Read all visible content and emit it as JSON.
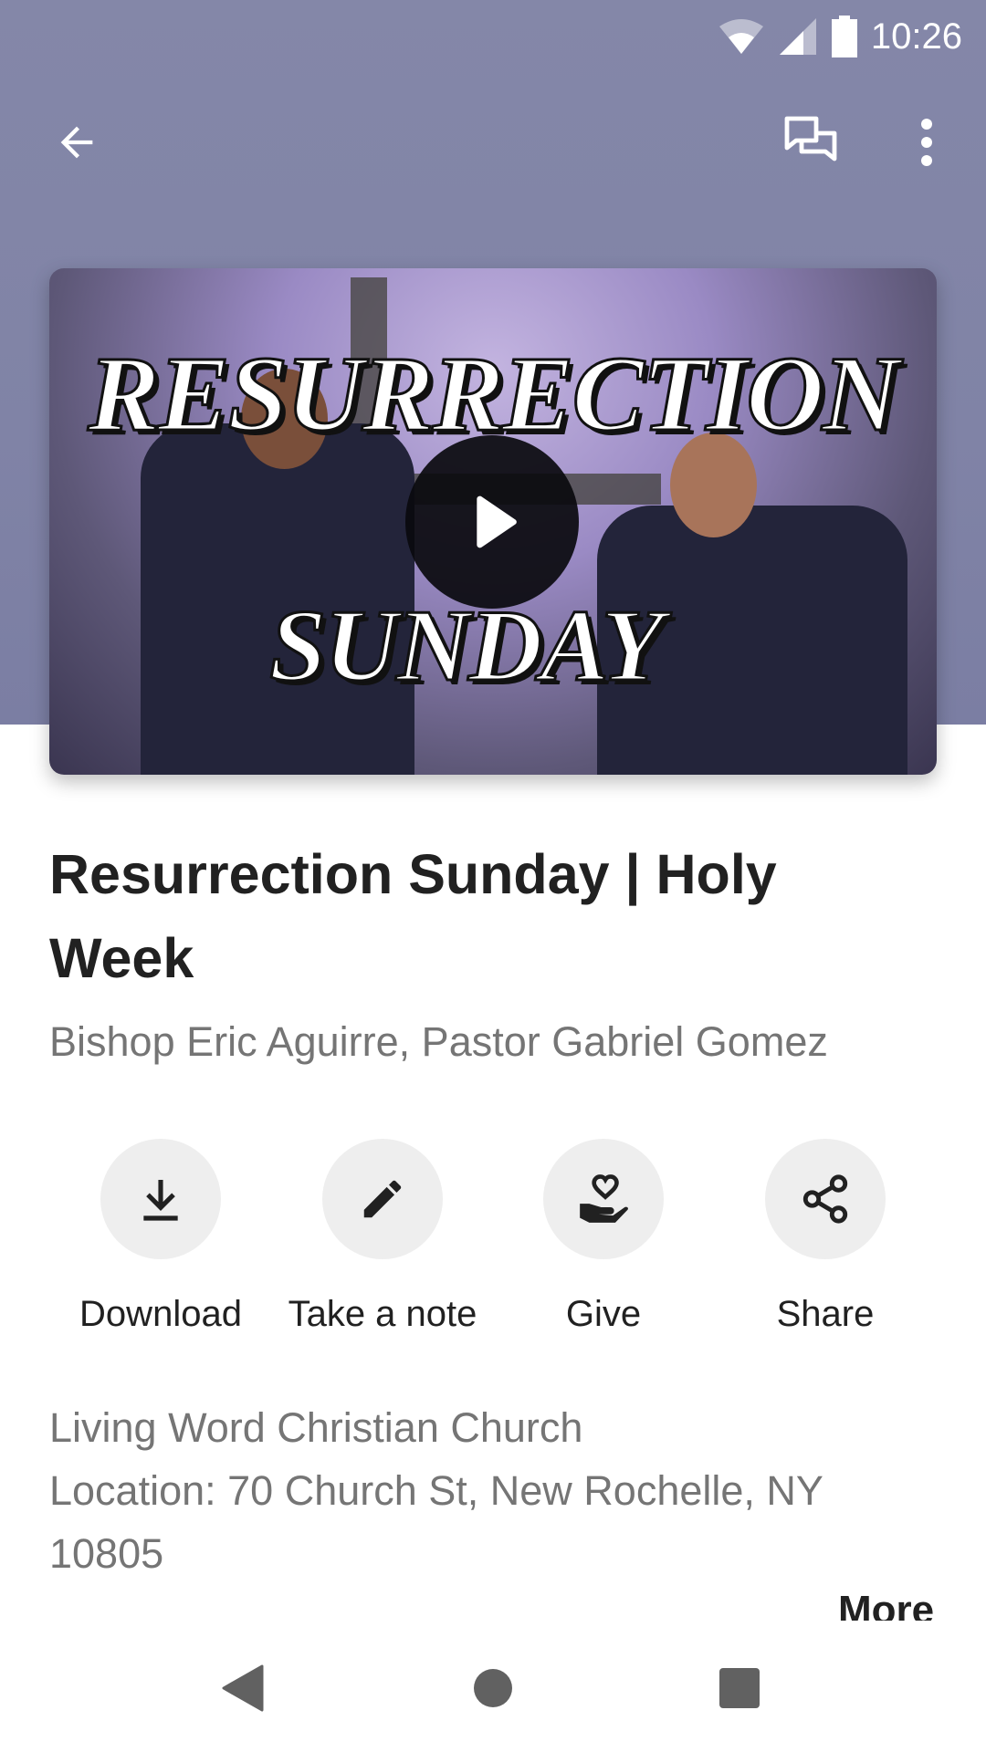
{
  "status_bar": {
    "time": "10:26",
    "icons": [
      "wifi-icon",
      "cell-signal-icon",
      "battery-icon"
    ]
  },
  "app_bar": {
    "back_icon": "arrow-back-icon",
    "chat_icon": "chat-bubbles-icon",
    "menu_icon": "more-vert-icon"
  },
  "video": {
    "overlay_line1": "RESURRECTION",
    "overlay_line2": "SUNDAY",
    "play_icon": "play-icon"
  },
  "sermon": {
    "title": "Resurrection Sunday | Holy Week",
    "speakers": "Bishop Eric Aguirre, Pastor Gabriel Gomez"
  },
  "actions": [
    {
      "label": "Download",
      "icon": "download-icon"
    },
    {
      "label": "Take a note",
      "icon": "pencil-icon"
    },
    {
      "label": "Give",
      "icon": "give-hand-heart-icon"
    },
    {
      "label": "Share",
      "icon": "share-icon"
    }
  ],
  "info": {
    "church": "Living Word Christian Church",
    "location": "Location: 70 Church St, New Rochelle, NY 10805",
    "more_label": "More"
  },
  "nav_bar": {
    "icons": [
      "nav-back-icon",
      "nav-home-icon",
      "nav-recents-icon"
    ]
  },
  "colors": {
    "header": "#8487a8",
    "text_primary": "#212121",
    "text_secondary": "#757575",
    "action_bg": "#eeeeee"
  }
}
